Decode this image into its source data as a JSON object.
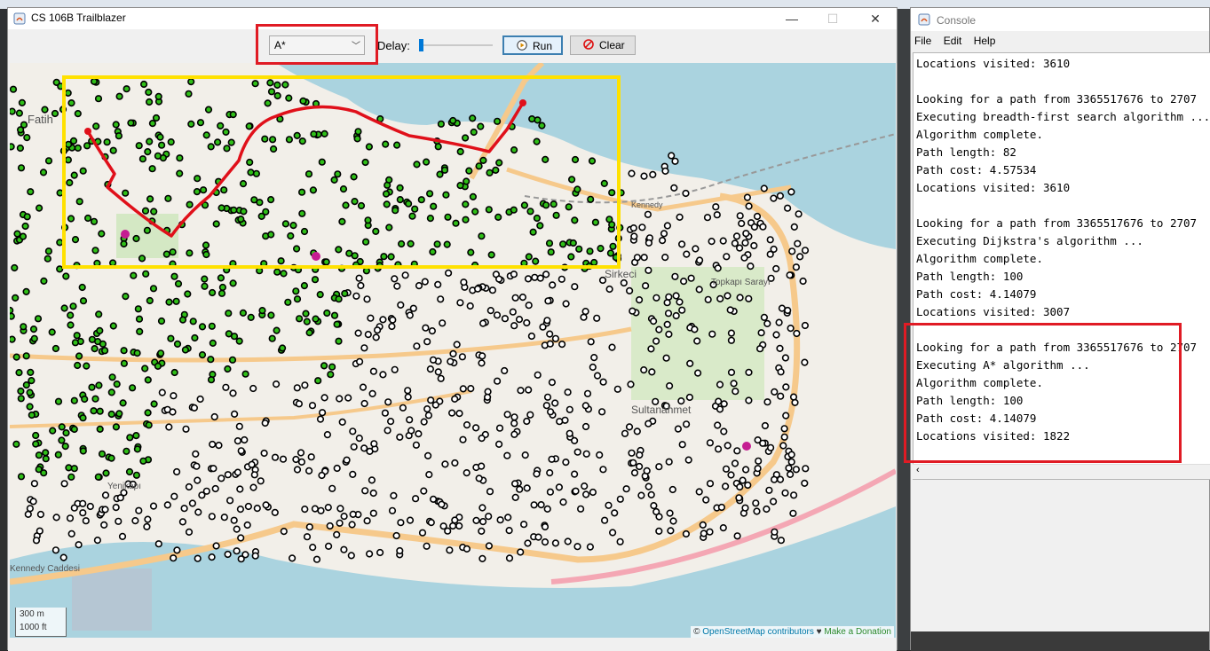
{
  "window": {
    "title": "CS 106B Trailblazer",
    "minimize_icon": "minimize-icon",
    "maximize_icon": "maximize-icon",
    "close_icon": "close-icon"
  },
  "toolbar": {
    "algorithm_selected": "A*",
    "delay_label": "Delay:",
    "delay_value": 0,
    "run_label": "Run",
    "clear_label": "Clear"
  },
  "map": {
    "labels": [
      "Fatih",
      "Sirkeci",
      "Topkapı Sarayı",
      "Sultanahmet",
      "Yenikapı",
      "Kennedy Caddesi",
      "Kennedy"
    ],
    "scale_m": "300 m",
    "scale_ft": "1000 ft",
    "attribution_prefix": "©",
    "attribution_link": "OpenStreetMap contributors",
    "attribution_heart": "♥",
    "attribution_donate": "Make a Donation"
  },
  "console": {
    "title": "Console",
    "menu": [
      "File",
      "Edit",
      "Help"
    ],
    "lines": [
      "Locations visited: 3610",
      "",
      "Looking for a path from 3365517676 to 2707",
      "Executing breadth-first search algorithm ...",
      "Algorithm complete.",
      "Path length: 82",
      "Path cost: 4.57534",
      "Locations visited: 3610",
      "",
      "Looking for a path from 3365517676 to 2707",
      "Executing Dijkstra's algorithm ...",
      "Algorithm complete.",
      "Path length: 100",
      "Path cost: 4.14079",
      "Locations visited: 3007",
      "",
      "Looking for a path from 3365517676 to 2707",
      "Executing A* algorithm ...",
      "Algorithm complete.",
      "Path length: 100",
      "Path cost: 4.14079",
      "Locations visited: 1822"
    ],
    "scroll_left_icon": "chevron-left-icon"
  },
  "colors": {
    "visited": "#2fbf18",
    "unvisited": "#ffffff",
    "path": "#e0101a",
    "highlight_red": "#e01b24",
    "highlight_yellow": "#ffe100",
    "water": "#aad3df"
  }
}
